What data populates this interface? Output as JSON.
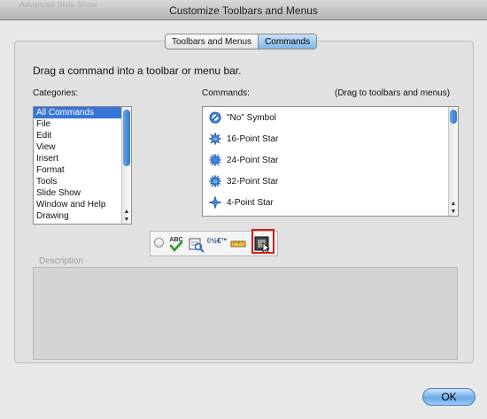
{
  "window": {
    "title": "Customize Toolbars and Menus",
    "background_title": "Advanced Slide Show"
  },
  "tabs": [
    {
      "label": "Toolbars and Menus",
      "active": false
    },
    {
      "label": "Commands",
      "active": true
    }
  ],
  "instruction": "Drag a command into a toolbar or menu bar.",
  "categories": {
    "label": "Categories:",
    "items": [
      "All Commands",
      "File",
      "Edit",
      "View",
      "Insert",
      "Format",
      "Tools",
      "Slide Show",
      "Window and Help",
      "Drawing"
    ],
    "selected": "All Commands"
  },
  "commands": {
    "label": "Commands:",
    "hint": "(Drag to toolbars and menus)",
    "items": [
      {
        "label": "\"No\" Symbol",
        "icon": "no-symbol-icon"
      },
      {
        "label": "16-Point Star",
        "icon": "star-16-icon"
      },
      {
        "label": "24-Point Star",
        "icon": "star-24-icon"
      },
      {
        "label": "32-Point Star",
        "icon": "star-32-icon"
      },
      {
        "label": "4-Point Star",
        "icon": "star-4-icon"
      }
    ]
  },
  "toolbar_strip": {
    "icons": [
      "spelling-icon",
      "research-icon",
      "symbols-icon",
      "ruler-icon",
      "frame-icon"
    ],
    "labels": {
      "abc": "ABC",
      "symbols": "©½€™"
    }
  },
  "description": {
    "label": "Description",
    "text": ""
  },
  "buttons": {
    "ok": "OK"
  },
  "colors": {
    "selection": "#3875d7",
    "highlight": "#d21f1f",
    "accent": "#6aa9e9"
  }
}
